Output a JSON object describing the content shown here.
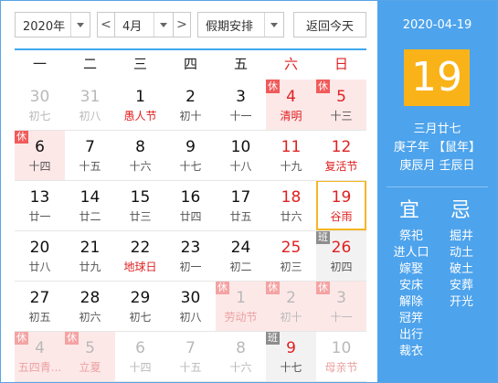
{
  "toolbar": {
    "year": "2020年",
    "prev": "<",
    "month": "4月",
    "next": ">",
    "holiday_select": "假期安排",
    "today_button": "返回今天"
  },
  "weekdays": [
    "一",
    "二",
    "三",
    "四",
    "五",
    "六",
    "日"
  ],
  "weeks": [
    [
      {
        "d": "30",
        "s": "初七",
        "other": true
      },
      {
        "d": "31",
        "s": "初八",
        "other": true
      },
      {
        "d": "1",
        "s": "愚人节",
        "fest": true
      },
      {
        "d": "2",
        "s": "初十"
      },
      {
        "d": "3",
        "s": "十一"
      },
      {
        "d": "4",
        "s": "清明",
        "fest": true,
        "badge": "休",
        "weekend": true
      },
      {
        "d": "5",
        "s": "十三",
        "badge": "休",
        "weekend": true
      }
    ],
    [
      {
        "d": "6",
        "s": "十四",
        "badge": "休",
        "holidayWeekday": true
      },
      {
        "d": "7",
        "s": "十五"
      },
      {
        "d": "8",
        "s": "十六"
      },
      {
        "d": "9",
        "s": "十七"
      },
      {
        "d": "10",
        "s": "十八"
      },
      {
        "d": "11",
        "s": "十九",
        "weekend": true
      },
      {
        "d": "12",
        "s": "复活节",
        "fest": true,
        "weekend": true
      }
    ],
    [
      {
        "d": "13",
        "s": "廿一"
      },
      {
        "d": "14",
        "s": "廿二"
      },
      {
        "d": "15",
        "s": "廿三"
      },
      {
        "d": "16",
        "s": "廿四"
      },
      {
        "d": "17",
        "s": "廿五"
      },
      {
        "d": "18",
        "s": "廿六",
        "weekend": true
      },
      {
        "d": "19",
        "s": "谷雨",
        "today": true,
        "weekend": true
      }
    ],
    [
      {
        "d": "20",
        "s": "廿八"
      },
      {
        "d": "21",
        "s": "廿九"
      },
      {
        "d": "22",
        "s": "地球日",
        "fest": true
      },
      {
        "d": "23",
        "s": "初一"
      },
      {
        "d": "24",
        "s": "初二"
      },
      {
        "d": "25",
        "s": "初三",
        "weekend": true
      },
      {
        "d": "26",
        "s": "初四",
        "badge": "班"
      }
    ],
    [
      {
        "d": "27",
        "s": "初五"
      },
      {
        "d": "28",
        "s": "初六"
      },
      {
        "d": "29",
        "s": "初七"
      },
      {
        "d": "30",
        "s": "初八"
      },
      {
        "d": "1",
        "s": "劳动节",
        "fest": true,
        "other": true,
        "badge": "休"
      },
      {
        "d": "2",
        "s": "初十",
        "other": true,
        "badge": "休"
      },
      {
        "d": "3",
        "s": "十一",
        "other": true,
        "badge": "休"
      }
    ],
    [
      {
        "d": "4",
        "s": "五四青...",
        "fest": true,
        "other": true,
        "badge": "休"
      },
      {
        "d": "5",
        "s": "立夏",
        "fest": true,
        "other": true,
        "badge": "休"
      },
      {
        "d": "6",
        "s": "十四",
        "other": true
      },
      {
        "d": "7",
        "s": "十五",
        "other": true
      },
      {
        "d": "8",
        "s": "十六",
        "other": true
      },
      {
        "d": "9",
        "s": "十七",
        "badge": "班"
      },
      {
        "d": "10",
        "s": "母亲节",
        "fest": true,
        "other": true
      }
    ]
  ],
  "panel": {
    "date": "2020-04-19",
    "day": "19",
    "lunar": "三月廿七",
    "ganzhi_year": "庚子年 【鼠年】",
    "ganzhi_month_day": "庚辰月 壬辰日",
    "yi_title": "宜",
    "ji_title": "忌",
    "yi": [
      "祭祀",
      "进人口",
      "嫁娶",
      "安床",
      "解除",
      "冠笄",
      "出行",
      "裁衣"
    ],
    "ji": [
      "掘井",
      "动土",
      "破土",
      "安葬",
      "开光"
    ]
  },
  "colors": {
    "accent_blue": "#4da3ec",
    "today_gold": "#f9b318",
    "holiday_red": "#f15a5a",
    "holiday_bg": "#fde8e8",
    "workday_gray": "#8d8d8d"
  }
}
